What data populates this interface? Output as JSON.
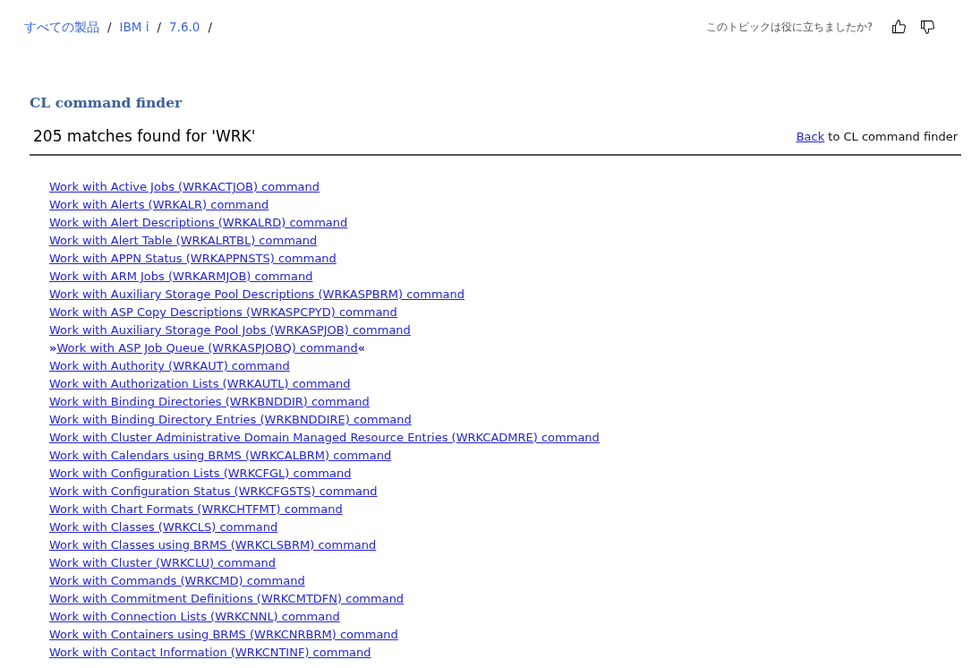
{
  "breadcrumb": [
    {
      "label": "すべての製品",
      "separator": "/"
    },
    {
      "label": "IBM i",
      "separator": "/"
    },
    {
      "label": "7.6.0",
      "separator": "/"
    }
  ],
  "feedback": {
    "question": "このトピックは役に立ちましたか?",
    "buttons": [
      {
        "kind": "thumbs_up"
      },
      {
        "kind": "thumbs_down"
      }
    ]
  },
  "title": "CL command finder",
  "results_heading": "205 matches found for 'WRK'",
  "back_sentence": {
    "link": "Back",
    "rest": "to CL command finder"
  },
  "commands": [
    {
      "text": "Work with Active Jobs (WRKACTJOB) command"
    },
    {
      "text": "Work with Alerts (WRKALR) command"
    },
    {
      "text": "Work with Alert Descriptions (WRKALRD) command"
    },
    {
      "text": "Work with Alert Table (WRKALRTBL) command"
    },
    {
      "text": "Work with APPN Status (WRKAPPNSTS) command"
    },
    {
      "text": "Work with ARM Jobs (WRKARMJOB) command"
    },
    {
      "text": "Work with Auxiliary Storage Pool Descriptions (WRKASPBRM) command"
    },
    {
      "text": "Work with ASP Copy Descriptions (WRKASPCPYD) command"
    },
    {
      "text": "Work with Auxiliary Storage Pool Jobs (WRKASPJOB) command"
    },
    {
      "text": "Work with ASP Job Queue (WRKASPJOBQ) command",
      "mark_before": "»",
      "mark_after": "«"
    },
    {
      "text": "Work with Authority (WRKAUT) command"
    },
    {
      "text": "Work with Authorization Lists (WRKAUTL) command"
    },
    {
      "text": "Work with Binding Directories (WRKBNDDIR) command"
    },
    {
      "text": "Work with Binding Directory Entries (WRKBNDDIRE) command"
    },
    {
      "text": "Work with Cluster Administrative Domain Managed Resource Entries (WRKCADMRE) command"
    },
    {
      "text": "Work with Calendars using BRMS (WRKCALBRM) command"
    },
    {
      "text": "Work with Configuration Lists (WRKCFGL) command"
    },
    {
      "text": "Work with Configuration Status (WRKCFGSTS) command"
    },
    {
      "text": "Work with Chart Formats (WRKCHTFMT) command"
    },
    {
      "text": "Work with Classes (WRKCLS) command"
    },
    {
      "text": "Work with Classes using BRMS (WRKCLSBRM) command"
    },
    {
      "text": "Work with Cluster (WRKCLU) command"
    },
    {
      "text": "Work with Commands (WRKCMD) command"
    },
    {
      "text": "Work with Commitment Definitions (WRKCMTDFN) command"
    },
    {
      "text": "Work with Connection Lists (WRKCNNL) command"
    },
    {
      "text": "Work with Containers using BRMS (WRKCNRBRM) command"
    },
    {
      "text": "Work with Contact Information (WRKCNTINF) command"
    }
  ]
}
